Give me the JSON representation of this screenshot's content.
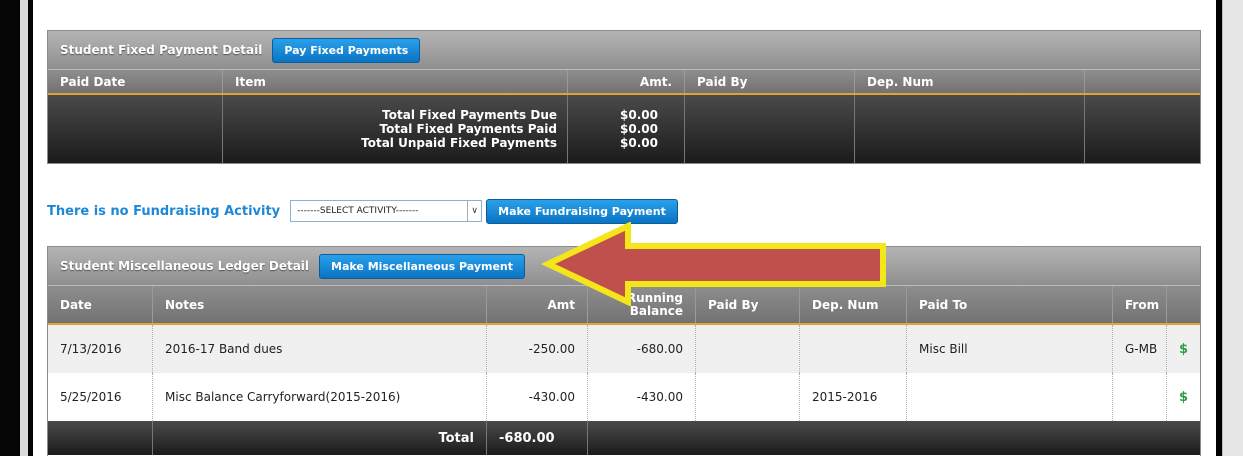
{
  "fixed_panel": {
    "title": "Student Fixed Payment Detail",
    "pay_button": "Pay Fixed Payments",
    "columns": [
      "Paid Date",
      "Item",
      "Amt.",
      "Paid By",
      "Dep. Num"
    ],
    "totals": {
      "labels": [
        "Total Fixed Payments Due",
        "Total Fixed Payments Paid",
        "Total Unpaid Fixed Payments"
      ],
      "values": [
        "$0.00",
        "$0.00",
        "$0.00"
      ]
    }
  },
  "fundraising": {
    "label": "There is no Fundraising Activity",
    "select_value": "-------SELECT ACTIVITY-------",
    "button": "Make Fundraising Payment"
  },
  "misc_panel": {
    "title": "Student Miscellaneous Ledger Detail",
    "pay_button": "Make Miscellaneous Payment",
    "columns": {
      "date": "Date",
      "notes": "Notes",
      "amt": "Amt",
      "running_1": "Running",
      "running_2": "Balance",
      "paid_by": "Paid By",
      "dep_num": "Dep. Num",
      "paid_to": "Paid To",
      "from": "From"
    },
    "rows": [
      {
        "date": "7/13/2016",
        "notes": "2016-17 Band dues",
        "amt": "-250.00",
        "running": "-680.00",
        "paid_by": "",
        "dep_num": "",
        "paid_to": "Misc Bill",
        "from": "G-MB",
        "icon": "$"
      },
      {
        "date": "5/25/2016",
        "notes": "Misc Balance Carryforward(2015-2016)",
        "amt": "-430.00",
        "running": "-430.00",
        "paid_by": "",
        "dep_num": "2015-2016",
        "paid_to": "",
        "from": "",
        "icon": "$"
      }
    ],
    "total_label": "Total",
    "total_value": "-680.00"
  },
  "colors": {
    "accent_blue": "#1e88d6",
    "arrow_fill": "#c0504d",
    "arrow_stroke": "#f5e61a",
    "header_underline": "#e2a23a"
  }
}
